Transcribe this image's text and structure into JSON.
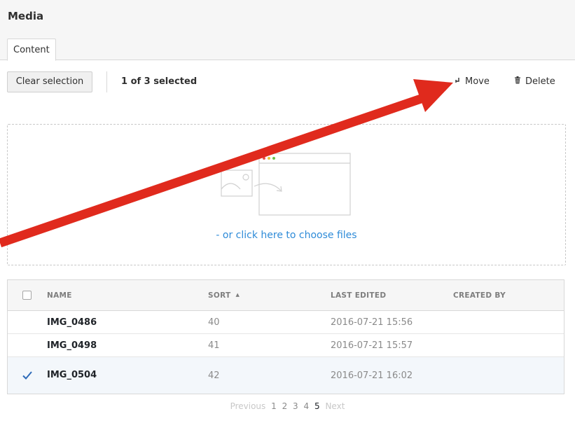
{
  "header": {
    "title": "Media"
  },
  "tabs": [
    {
      "label": "Content"
    }
  ],
  "toolbar": {
    "clear_selection_label": "Clear selection",
    "selection_count": "1 of 3 selected",
    "move_label": "Move",
    "delete_label": "Delete"
  },
  "dropzone": {
    "link_text": "- or click here to choose files"
  },
  "table": {
    "columns": {
      "name": "NAME",
      "sort": "SORT",
      "last_edited": "LAST EDITED",
      "created_by": "CREATED BY"
    },
    "sort_indicator": "▲",
    "rows": [
      {
        "name": "IMG_0486",
        "sort": "40",
        "last_edited": "2016-07-21 15:56",
        "created_by": "",
        "selected": false
      },
      {
        "name": "IMG_0498",
        "sort": "41",
        "last_edited": "2016-07-21 15:57",
        "created_by": "",
        "selected": false
      },
      {
        "name": "IMG_0504",
        "sort": "42",
        "last_edited": "2016-07-21 16:02",
        "created_by": "",
        "selected": true
      }
    ]
  },
  "pagination": {
    "previous": "Previous",
    "pages": [
      "1",
      "2",
      "3",
      "4",
      "5"
    ],
    "current": "5",
    "next": "Next"
  },
  "icons": {
    "move": "move-icon",
    "delete": "trash-icon",
    "selected_check": "checkmark-icon",
    "annotation": "red-arrow-annotation"
  },
  "colors": {
    "accent": "#2e8bd8",
    "annotation_arrow": "#e02a1d",
    "selected_row": "#f3f7fb"
  }
}
